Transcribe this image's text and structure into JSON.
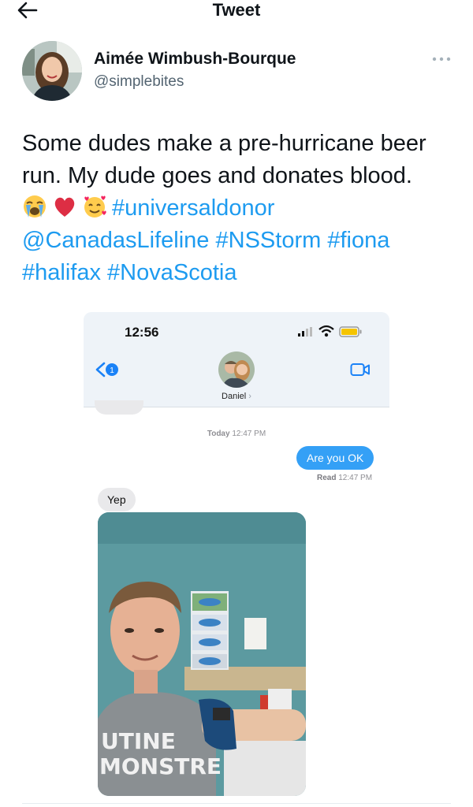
{
  "topbar": {
    "title": "Tweet",
    "back_icon": "arrow-left-icon"
  },
  "author": {
    "name": "Aimée Wimbush-Bourque",
    "handle": "@simplebites",
    "more_icon": "more-horizontal-icon"
  },
  "tweet": {
    "line1": "Some dudes make a pre-hurricane beer",
    "line2": "run. My dude goes and donates blood.",
    "emojis": [
      "loudly-crying-face-emoji",
      "red-heart-emoji",
      "smiling-face-with-hearts-emoji"
    ],
    "hashtag_universaldonor": "#universaldonor",
    "mention_canadaslifeline": "@CanadasLifeline",
    "hashtag_nsstorm": "#NSStorm",
    "hashtag_fiona": "#fiona",
    "hashtag_halifax": "#halifax",
    "hashtag_novascotia": "#NovaScotia"
  },
  "screenshot": {
    "status_time": "12:56",
    "back_badge": "1",
    "contact_name": "Daniel",
    "contact_chevron": "›",
    "video_icon": "video-camera-icon",
    "timestamp_day": "Today",
    "timestamp_time": "12:47 PM",
    "sent_message": "Are you OK",
    "read_label": "Read",
    "read_time": "12:47 PM",
    "received_message": "Yep",
    "selfie_shirt_line1": "UTINE",
    "selfie_shirt_line2": "MONSTRE"
  },
  "colors": {
    "link": "#1d9bf0",
    "imessage_blue": "#34a0f6",
    "received_gray": "#e9e9eb"
  }
}
